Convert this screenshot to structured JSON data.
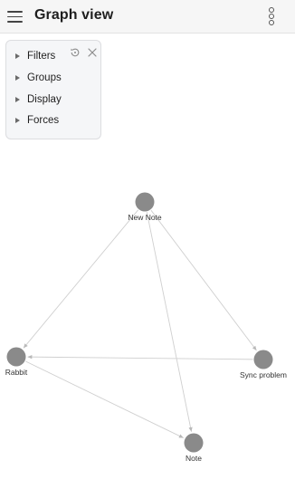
{
  "header": {
    "title": "Graph view"
  },
  "panel": {
    "items": [
      {
        "label": "Filters"
      },
      {
        "label": "Groups"
      },
      {
        "label": "Display"
      },
      {
        "label": "Forces"
      }
    ]
  },
  "graph": {
    "nodes": [
      {
        "id": "new-note",
        "label": "New Note"
      },
      {
        "id": "rabbit",
        "label": "Rabbit"
      },
      {
        "id": "sync-problem",
        "label": "Sync problem"
      },
      {
        "id": "note",
        "label": "Note"
      }
    ],
    "edges": [
      {
        "from": "new-note",
        "to": "rabbit"
      },
      {
        "from": "new-note",
        "to": "sync-problem"
      },
      {
        "from": "new-note",
        "to": "note"
      },
      {
        "from": "rabbit",
        "to": "note"
      },
      {
        "from": "sync-problem",
        "to": "rabbit"
      }
    ],
    "colors": {
      "node": "#8a8a8a",
      "edge": "#cfcfcf"
    }
  }
}
